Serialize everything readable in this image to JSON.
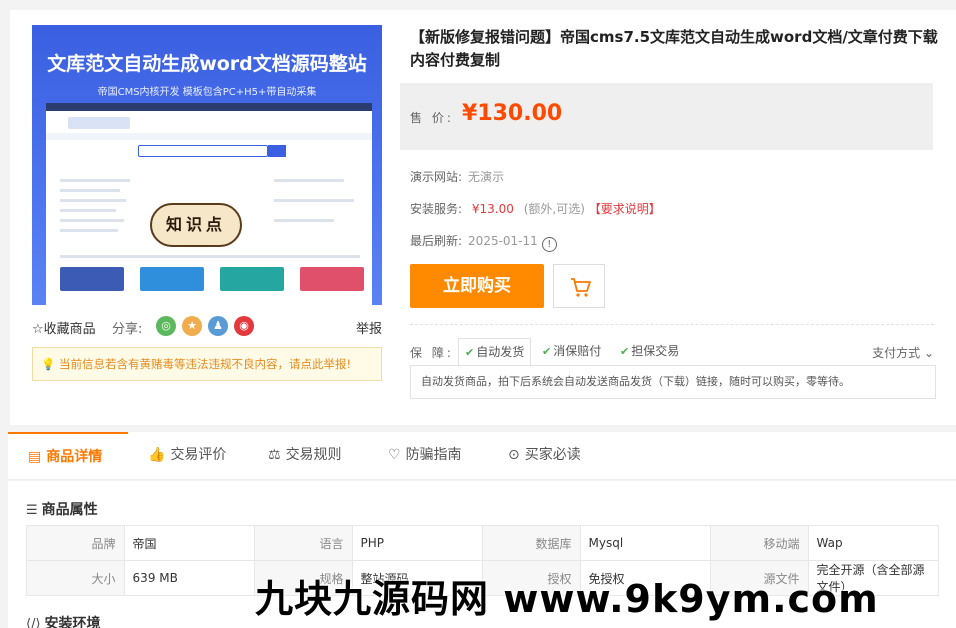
{
  "product": {
    "image": {
      "title": "文库范文自动生成word文档源码整站",
      "subtitle": "帝国CMS内核开发 模板包含PC+H5+带自动采集",
      "badge": "知识点"
    },
    "favorite_label": "☆收藏商品",
    "share_label": "分享:",
    "report_label": "举报",
    "notice": "当前信息若含有黄赌毒等违法违规不良内容，请点此举报!",
    "title": "【新版修复报错问题】帝国cms7.5文库范文自动生成word文档/文章付费下载内容付费复制",
    "price_label": "售 价:",
    "price": "¥130.00",
    "demo_label": "演示网站:",
    "demo_value": "无演示",
    "install_label": "安装服务:",
    "install_price": "¥13.00",
    "install_note": "(额外,可选)",
    "install_req": "【要求说明】",
    "refresh_label": "最后刷新:",
    "refresh_value": "2025-01-11",
    "buy_label": "立即购买",
    "guarantee_label": "保 障:",
    "guarantees": [
      "自动发货",
      "消保赔付",
      "担保交易"
    ],
    "pay_way": "支付方式",
    "guarantee_desc": "自动发货商品，拍下后系统会自动发送商品发货（下载）链接，随时可以购买，零等待。"
  },
  "tabs": [
    "商品详情",
    "交易评价",
    "交易规则",
    "防骗指南",
    "买家必读"
  ],
  "attributes": {
    "heading": "商品属性",
    "rows": [
      [
        [
          "品牌",
          "帝国"
        ],
        [
          "语言",
          "PHP"
        ],
        [
          "数据库",
          "Mysql"
        ],
        [
          "移动端",
          "Wap"
        ]
      ],
      [
        [
          "大小",
          "639 MB"
        ],
        [
          "规格",
          "整站源码"
        ],
        [
          "授权",
          "免授权"
        ],
        [
          "源文件",
          "完全开源（含全部源文件）"
        ]
      ]
    ]
  },
  "install_env_heading": "安装环境",
  "watermark": "九块九源码网 www.9k9ym.com",
  "colors": {
    "accent": "#ff7800",
    "price": "#ff4a00",
    "buy": "#ff8a00"
  }
}
